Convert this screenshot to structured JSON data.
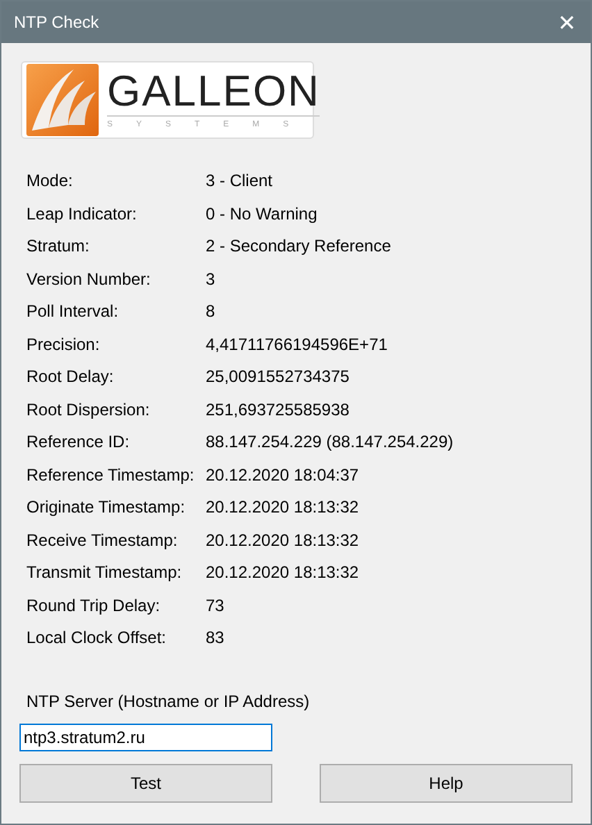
{
  "window": {
    "title": "NTP Check",
    "close": "✕"
  },
  "logo": {
    "name": "GALLEON",
    "tagline": "SYSTEMS"
  },
  "fields": [
    {
      "label": "Mode:",
      "value": "3 - Client"
    },
    {
      "label": "Leap Indicator:",
      "value": "0 - No Warning"
    },
    {
      "label": "Stratum:",
      "value": "2 - Secondary Reference"
    },
    {
      "label": "Version Number:",
      "value": "3"
    },
    {
      "label": "Poll Interval:",
      "value": "8"
    },
    {
      "label": "Precision:",
      "value": "4,41711766194596E+71"
    },
    {
      "label": "Root Delay:",
      "value": "25,0091552734375"
    },
    {
      "label": "Root Dispersion:",
      "value": "251,693725585938"
    },
    {
      "label": "Reference ID:",
      "value": "88.147.254.229 (88.147.254.229)"
    },
    {
      "label": "Reference Timestamp:",
      "value": "20.12.2020 18:04:37"
    },
    {
      "label": "Originate Timestamp:",
      "value": "20.12.2020 18:13:32"
    },
    {
      "label": "Receive Timestamp:",
      "value": "20.12.2020 18:13:32"
    },
    {
      "label": "Transmit Timestamp:",
      "value": "20.12.2020 18:13:32"
    },
    {
      "label": "Round Trip Delay:",
      "value": "73"
    },
    {
      "label": "Local Clock Offset:",
      "value": "83"
    }
  ],
  "server": {
    "label": "NTP Server (Hostname or IP Address)",
    "value": "ntp3.stratum2.ru"
  },
  "buttons": [
    "Test",
    "Help"
  ]
}
